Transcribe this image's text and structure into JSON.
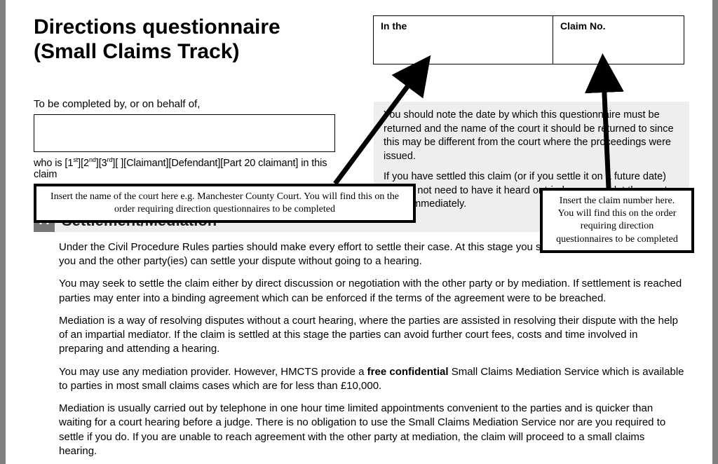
{
  "title_line1": "Directions questionnaire",
  "title_line2": "(Small Claims Track)",
  "box_in_the_label": "In the",
  "box_claim_no_label": "Claim No.",
  "completed_label": "To be completed by, or on behalf of,",
  "party_line_prefix": "who is [1",
  "party_line_sup1": "st",
  "party_line_mid1": "][2",
  "party_line_sup2": "nd",
  "party_line_mid2": "][3",
  "party_line_sup3": "rd",
  "party_line_suffix": "][     ][Claimant][Defendant][Part 20 claimant] in this claim",
  "note_p1": "You should note the date by which this questionnaire must be returned and the name of the court it should be returned to since this may be different from the court where the proceedings were issued.",
  "note_p2": "If you have settled this claim (or if you settle it on a future date) and do not need to have it heard or tried, you must let the court know immediately.",
  "section_letter": "A",
  "section_title": "Settlement/Mediation",
  "body_p1": "Under the Civil Procedure Rules parties should make every effort to settle their case. At this stage you should still think about whether you and the other party(ies) can settle your dispute without going to a hearing.",
  "body_p2": "You may seek to settle the claim either by direct discussion or negotiation with the other party or by mediation. If settlement is reached parties may enter into a binding agreement which can be enforced if the terms of the agreement were to be breached.",
  "body_p3": "Mediation is a way of resolving disputes without a court hearing, where the parties are assisted in resolving their dispute with the help of an impartial mediator. If the claim is settled at this stage the parties can avoid further court fees, costs and time involved in preparing and attending a hearing.",
  "body_p4a": "You may use any mediation provider. However, HMCTS provide a ",
  "body_p4_bold": "free confidential",
  "body_p4b": " Small Claims Mediation Service which is available to parties in most small claims cases which are for less than £10,000.",
  "body_p5": "Mediation is usually carried out by telephone in one hour time limited appointments convenient to the parties and is quicker than waiting for a court hearing before a judge. There is no obligation to use the Small Claims Mediation Service nor are you required to settle if you do. If you are unable to reach agreement with the other party at mediation, the claim will proceed to a small claims hearing.",
  "callout_left": "Insert the name of the court here e.g. Manchester County Court. You will find this on the order requiring direction questionnaires to be completed",
  "callout_right": "Insert the claim number here. You will find this on the order requiring direction questionnaires to be completed"
}
